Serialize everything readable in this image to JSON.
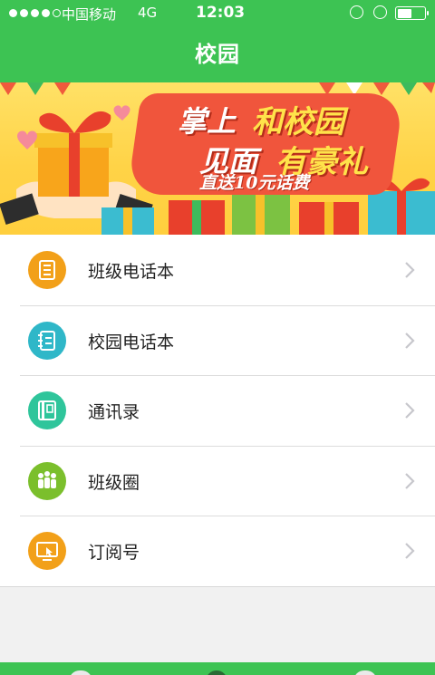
{
  "status_bar": {
    "carrier": "中国移动",
    "network": "4G",
    "time": "12:03",
    "signal_bars_filled": 4,
    "signal_bars_total": 5,
    "battery_level_percent": 55
  },
  "header": {
    "title": "校园"
  },
  "banner": {
    "line1_white": "掌上",
    "line1_yellow": "和校园",
    "line2_white": "见面",
    "line2_yellow": "有豪礼",
    "line3": "直送10元话费"
  },
  "menu": {
    "items": [
      {
        "label": "班级电话本",
        "icon": "class-phonebook-icon",
        "color": "#f2a019"
      },
      {
        "label": "校园电话本",
        "icon": "campus-phonebook-icon",
        "color": "#2fb7c8"
      },
      {
        "label": "通讯录",
        "icon": "contacts-book-icon",
        "color": "#2fc59b"
      },
      {
        "label": "班级圈",
        "icon": "class-circle-icon",
        "color": "#7bbf2c"
      },
      {
        "label": "订阅号",
        "icon": "subscription-icon",
        "color": "#f2a019"
      }
    ]
  },
  "colors": {
    "brand_green": "#3dc353",
    "page_background": "#f1f1f1",
    "banner_red": "#f0553c",
    "banner_yellow_text": "#ffe34a"
  }
}
